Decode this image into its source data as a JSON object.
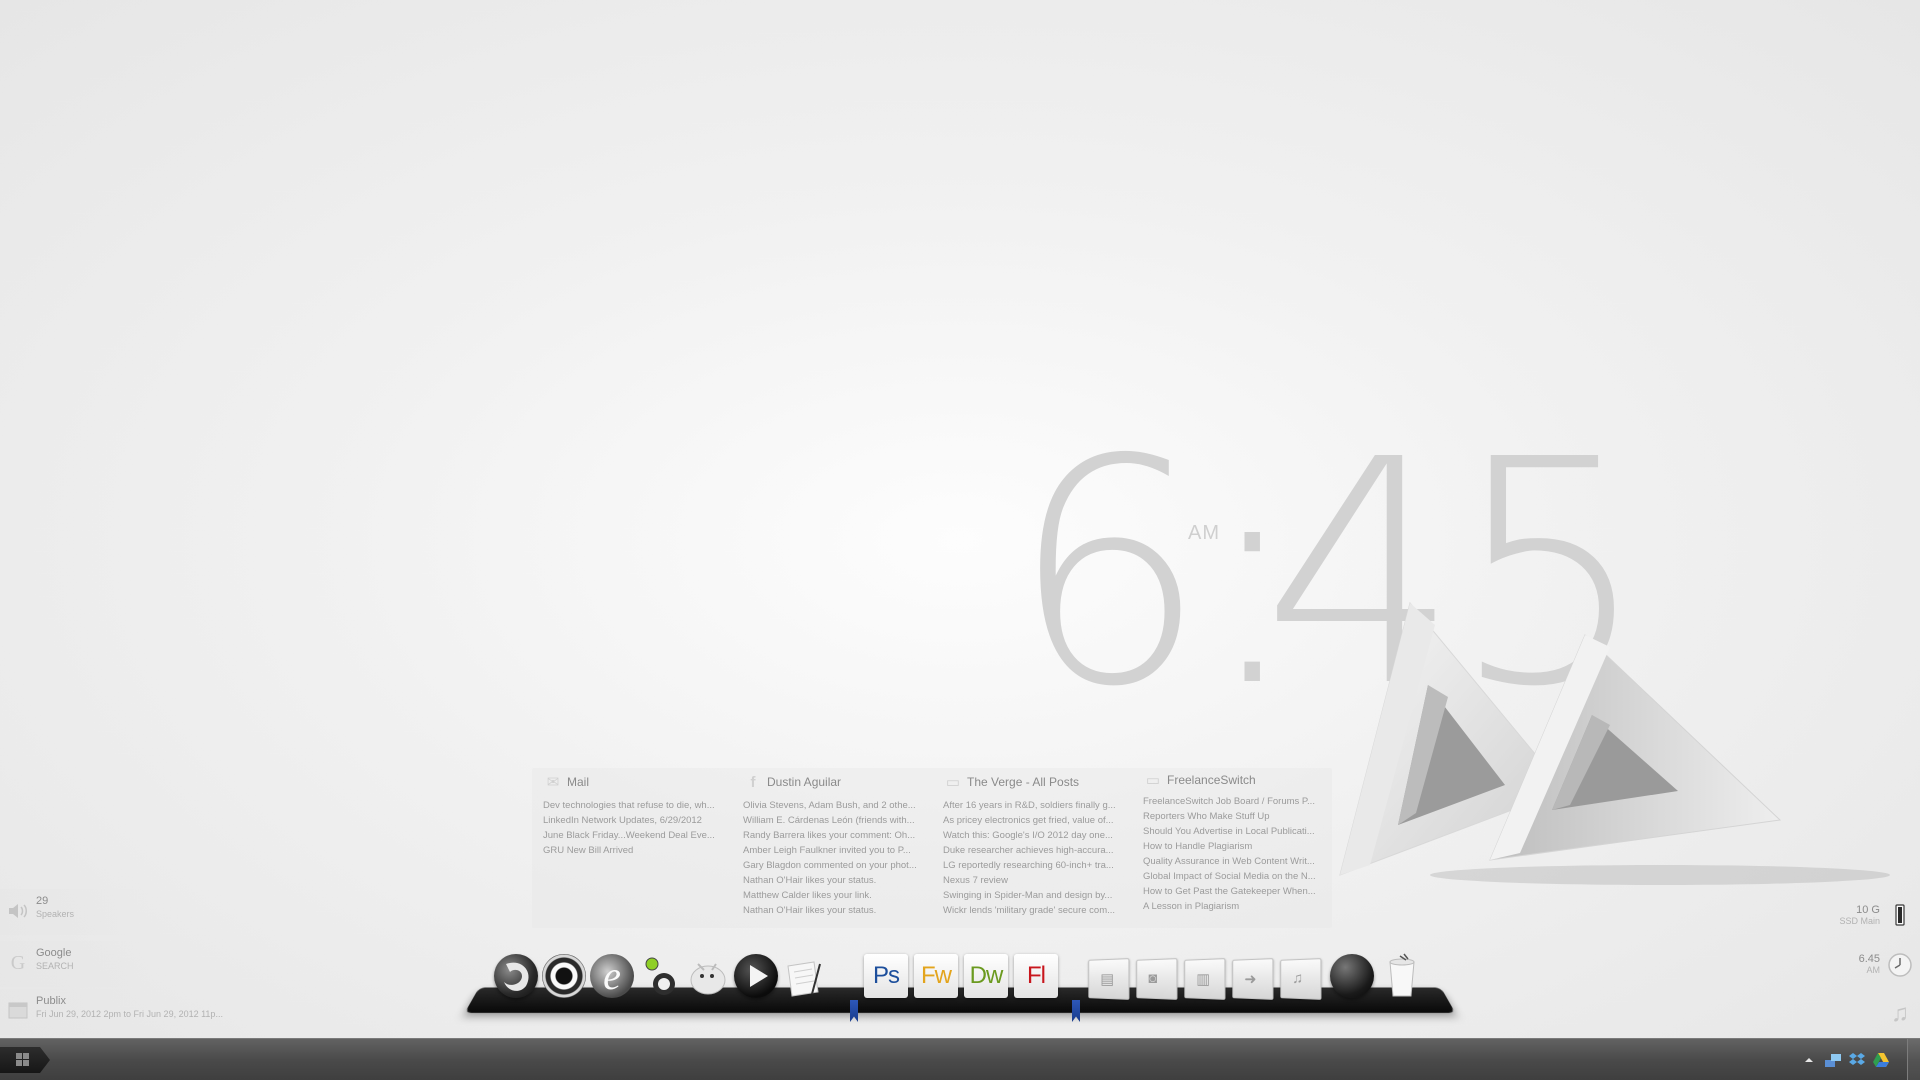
{
  "clock": {
    "hours": "6",
    "colon": ":",
    "minutes": "45",
    "ampm": "AM"
  },
  "feeds": [
    {
      "icon": "mail-icon",
      "title": "Mail",
      "items": [
        "Dev technologies that refuse to die, wh...",
        "LinkedIn Network Updates, 6/29/2012",
        "June Black Friday...Weekend Deal Eve...",
        "GRU New Bill Arrived"
      ]
    },
    {
      "icon": "facebook-icon",
      "title": "Dustin Aguilar",
      "items": [
        "Olivia Stevens, Adam Bush, and 2 othe...",
        "William E. Cárdenas León (friends with...",
        "Randy Barrera likes your comment: Oh...",
        "Amber Leigh Faulkner invited you to P...",
        "Gary Blagdon commented on your phot...",
        "Nathan O'Hair likes your status.",
        "Matthew Calder likes your link.",
        "Nathan O'Hair likes your status."
      ]
    },
    {
      "icon": "rss-icon",
      "title": "The Verge -  All Posts",
      "items": [
        "After 16 years in R&D, soldiers finally g...",
        "As pricey electronics get fried, value of...",
        "Watch this: Google's I/O 2012 day one...",
        "Duke researcher achieves high-accura...",
        "LG reportedly researching 60-inch+ tra...",
        "Nexus 7 review",
        "Swinging in Spider-Man and design by...",
        "Wickr lends 'military grade' secure com..."
      ]
    },
    {
      "icon": "rss-icon",
      "title": "FreelanceSwitch",
      "items": [
        "FreelanceSwitch Job Board / Forums P...",
        "Reporters Who Make Stuff Up",
        "Should You Advertise in Local Publicati...",
        "How to Handle Plagiarism",
        "Quality Assurance in Web Content Writ...",
        "Global Impact of Social Media on the N...",
        "How to Get Past the Gatekeeper When...",
        "A Lesson in Plagiarism"
      ]
    }
  ],
  "left_widgets": {
    "volume": {
      "icon": "speaker-icon",
      "value": "29",
      "label": "Speakers"
    },
    "search": {
      "icon": "google-icon",
      "value": "Google",
      "label": "SEARCH"
    },
    "calendar": {
      "icon": "calendar-icon",
      "value": "Publix",
      "label": "Fri Jun 29, 2012 2pm to Fri Jun 29, 2012 11p..."
    }
  },
  "right_widgets": {
    "disk": {
      "icon": "drive-icon",
      "value": "10 G",
      "label": "SSD Main"
    },
    "time": {
      "icon": "clock-icon",
      "value": "6.45",
      "label": "AM"
    },
    "music": {
      "icon": "music-note-icon"
    }
  },
  "dock": {
    "apps": [
      {
        "name": "firefox",
        "icon": "firefox-icon"
      },
      {
        "name": "media-center",
        "icon": "webcam-icon"
      },
      {
        "name": "internet-explorer",
        "icon": "ie-icon"
      },
      {
        "name": "messenger",
        "icon": "messenger-icon"
      },
      {
        "name": "pidgin",
        "icon": "pidgin-icon"
      },
      {
        "name": "media-player",
        "icon": "play-icon"
      },
      {
        "name": "notes",
        "icon": "notepad-icon"
      }
    ],
    "adobe": [
      {
        "label": "Ps",
        "color": "#1d4f9c"
      },
      {
        "label": "Fw",
        "color": "#e3a41c"
      },
      {
        "label": "Dw",
        "color": "#6b9a1f"
      },
      {
        "label": "Fl",
        "color": "#c8161d"
      }
    ],
    "folders": [
      {
        "icon": "documents-folder-icon",
        "glyph": "▤"
      },
      {
        "icon": "pictures-folder-icon",
        "glyph": "◙"
      },
      {
        "icon": "videos-folder-icon",
        "glyph": "▥"
      },
      {
        "icon": "downloads-folder-icon",
        "glyph": "➜"
      },
      {
        "icon": "music-folder-icon",
        "glyph": "♫"
      }
    ],
    "extras": [
      {
        "icon": "network-globe-icon"
      },
      {
        "icon": "recycle-bin-icon"
      }
    ]
  },
  "colors": {
    "clock": "#d2d2d2",
    "dock": "#111111",
    "taskbar": "#4a4a4a"
  }
}
